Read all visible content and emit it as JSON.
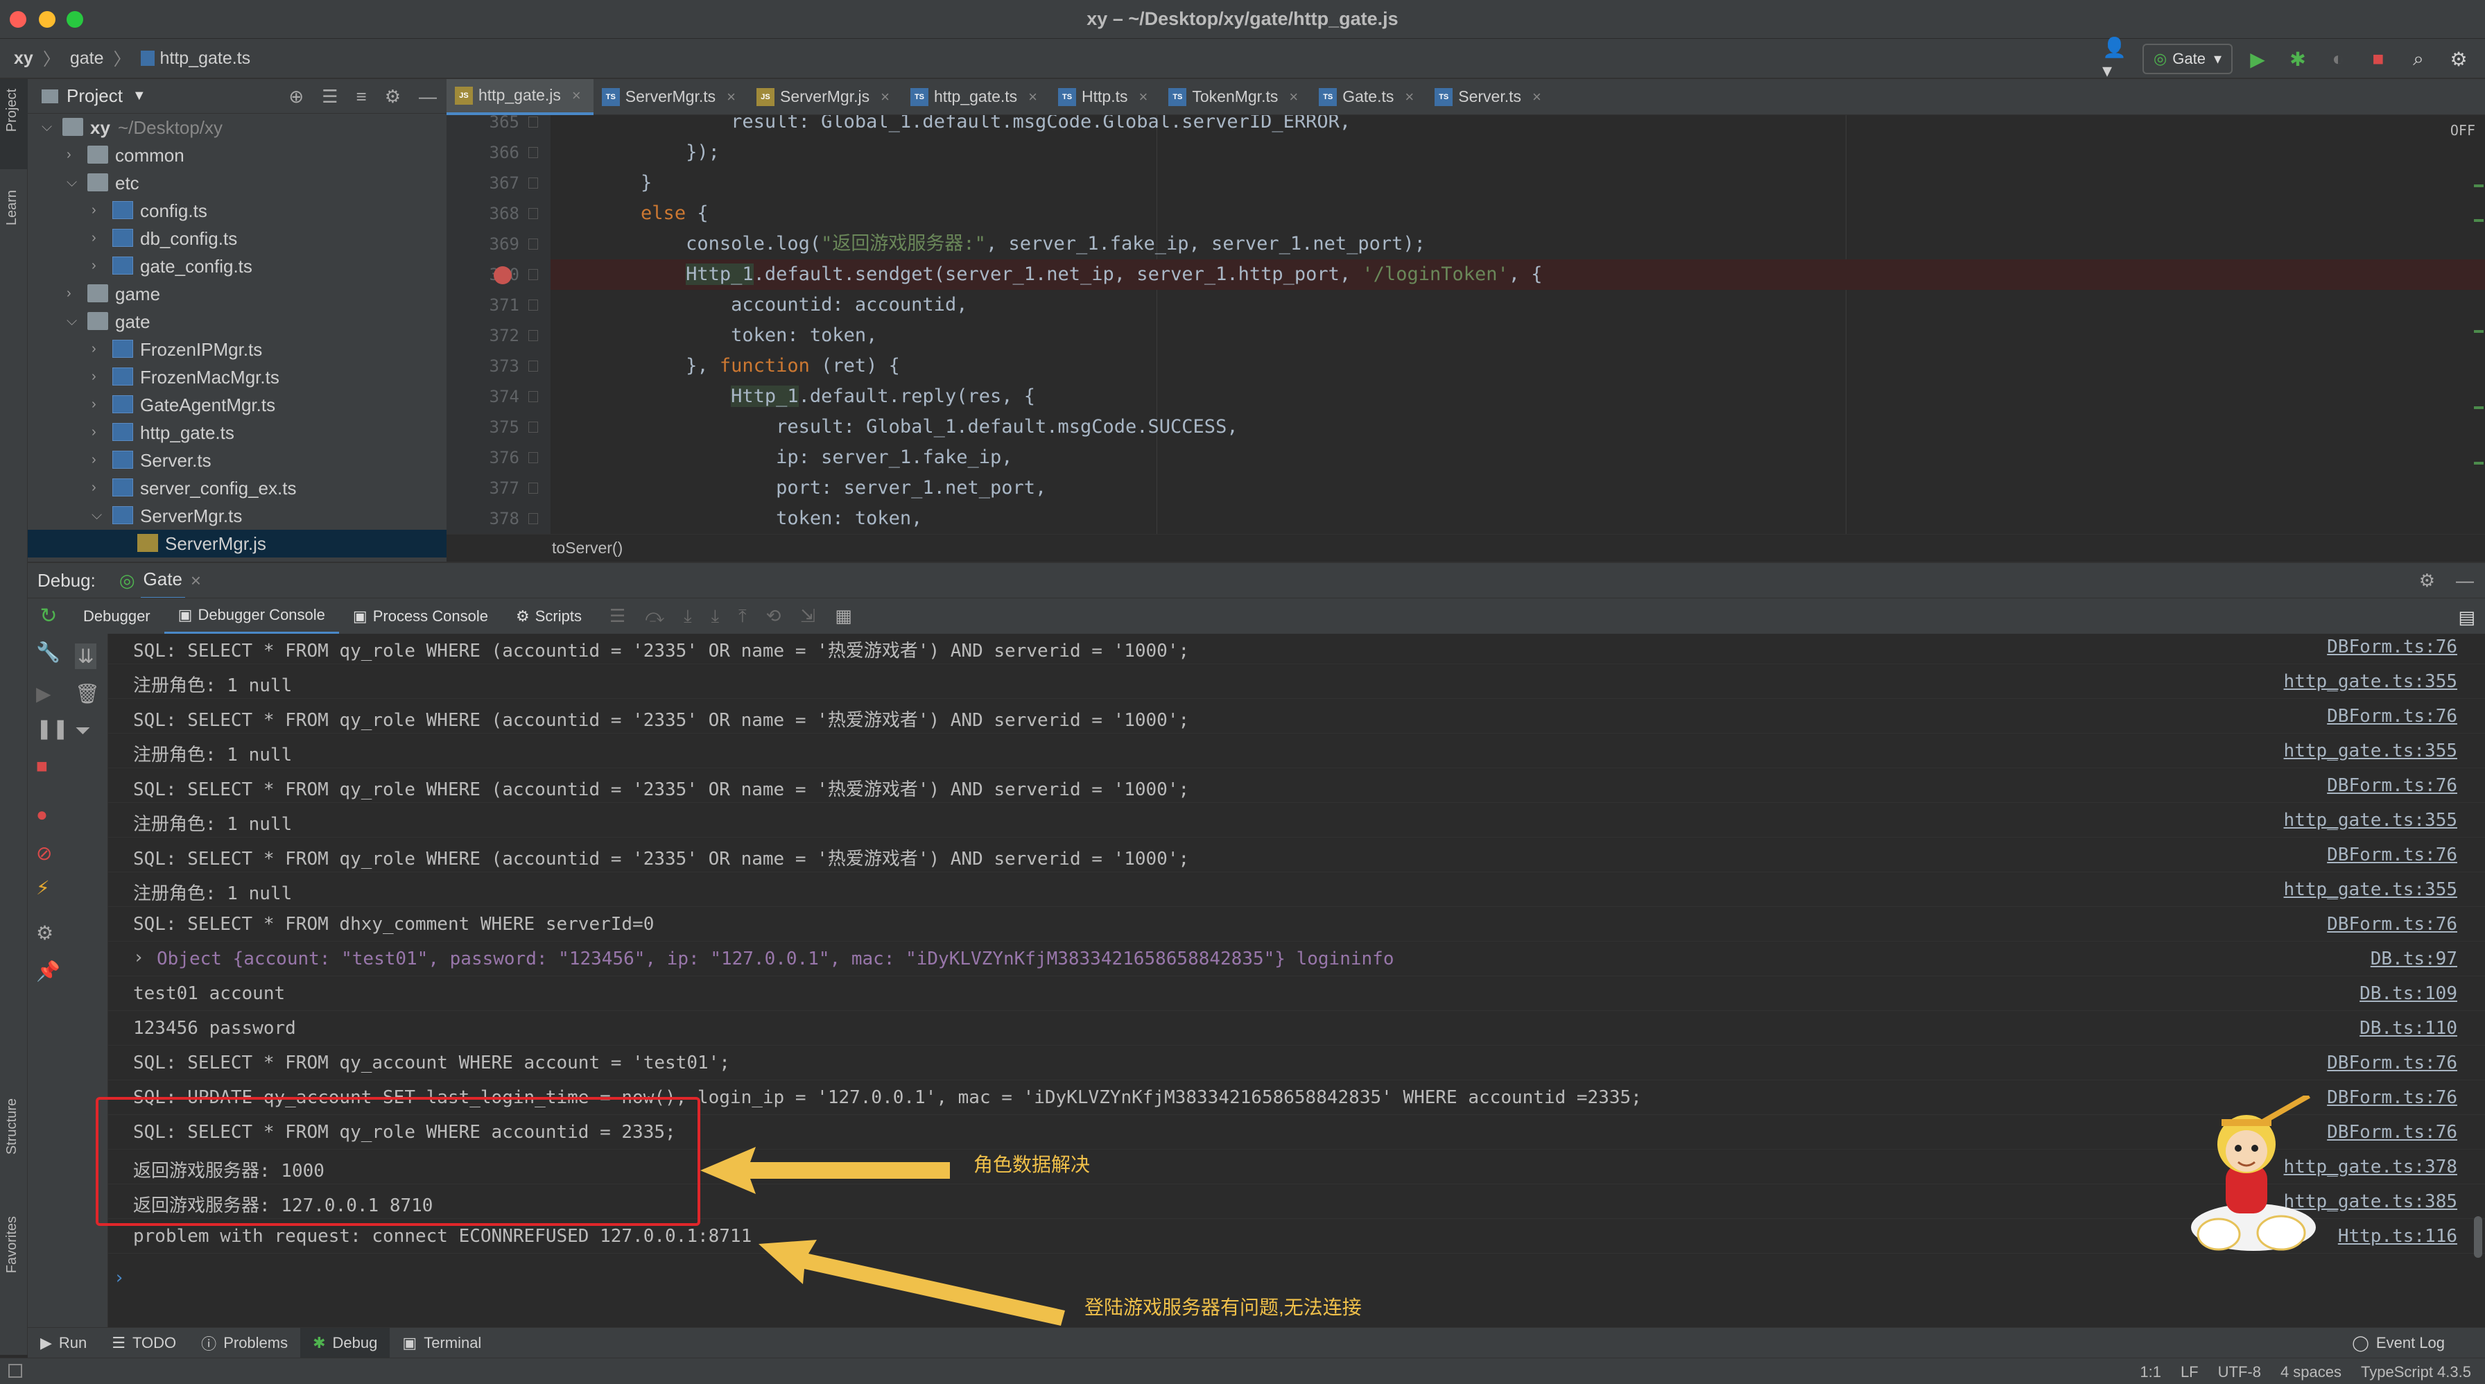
{
  "window": {
    "title": "xy – ~/Desktop/xy/gate/http_gate.js"
  },
  "colors": {
    "close": "#fe5f57",
    "minimize": "#febc2e",
    "maximize": "#28c840",
    "accent": "#4a88c7",
    "annotation": "#f0c04a",
    "highlight_box": "#e0262a"
  },
  "navbar": {
    "crumbs": [
      "xy",
      "gate",
      "http_gate.ts"
    ],
    "run_config": "Gate"
  },
  "left_stripe": {
    "project": "Project",
    "learn": "Learn",
    "structure": "Structure",
    "favorites": "Favorites"
  },
  "project": {
    "title": "Project",
    "tree": [
      {
        "label": "xy",
        "extra": "~/Desktop/xy",
        "type": "folder",
        "depth": 0,
        "expanded": true
      },
      {
        "label": "common",
        "type": "folder",
        "depth": 1,
        "expanded": false
      },
      {
        "label": "etc",
        "type": "folder",
        "depth": 1,
        "expanded": true
      },
      {
        "label": "config.ts",
        "type": "ts",
        "depth": 2,
        "expanded": false
      },
      {
        "label": "db_config.ts",
        "type": "ts",
        "depth": 2,
        "expanded": false
      },
      {
        "label": "gate_config.ts",
        "type": "ts",
        "depth": 2,
        "expanded": false
      },
      {
        "label": "game",
        "type": "folder",
        "depth": 1,
        "expanded": false
      },
      {
        "label": "gate",
        "type": "folder",
        "depth": 1,
        "expanded": true
      },
      {
        "label": "FrozenIPMgr.ts",
        "type": "ts",
        "depth": 2,
        "expanded": false
      },
      {
        "label": "FrozenMacMgr.ts",
        "type": "ts",
        "depth": 2,
        "expanded": false
      },
      {
        "label": "GateAgentMgr.ts",
        "type": "ts",
        "depth": 2,
        "expanded": false
      },
      {
        "label": "http_gate.ts",
        "type": "ts",
        "depth": 2,
        "expanded": false
      },
      {
        "label": "Server.ts",
        "type": "ts",
        "depth": 2,
        "expanded": false
      },
      {
        "label": "server_config_ex.ts",
        "type": "ts",
        "depth": 2,
        "expanded": false
      },
      {
        "label": "ServerMgr.ts",
        "type": "ts",
        "depth": 2,
        "expanded": true
      },
      {
        "label": "ServerMgr.js",
        "type": "js",
        "depth": 3,
        "selected": true
      }
    ]
  },
  "editor_tabs": [
    {
      "label": "http_gate.js",
      "type": "js",
      "active": true
    },
    {
      "label": "ServerMgr.ts",
      "type": "ts"
    },
    {
      "label": "ServerMgr.js",
      "type": "js"
    },
    {
      "label": "http_gate.ts",
      "type": "ts"
    },
    {
      "label": "Http.ts",
      "type": "ts"
    },
    {
      "label": "TokenMgr.ts",
      "type": "ts"
    },
    {
      "label": "Gate.ts",
      "type": "ts"
    },
    {
      "label": "Server.ts",
      "type": "ts"
    }
  ],
  "editor": {
    "off_label": "OFF",
    "breadcrumb": "toServer()",
    "lines": [
      {
        "n": "365",
        "tokens": [
          [
            "                ",
            ""
          ],
          [
            "result: Global_1.default.msgCode.Global.serverID_ERROR,",
            ""
          ]
        ]
      },
      {
        "n": "366",
        "tokens": [
          [
            "            });",
            ""
          ]
        ]
      },
      {
        "n": "367",
        "tokens": [
          [
            "        }",
            ""
          ]
        ]
      },
      {
        "n": "368",
        "tokens": [
          [
            "        ",
            ""
          ],
          [
            "else",
            "kw"
          ],
          [
            " {",
            ""
          ]
        ]
      },
      {
        "n": "369",
        "tokens": [
          [
            "            console.",
            ""
          ],
          [
            "log",
            ""
          ],
          [
            "(",
            ""
          ],
          [
            "\"返回游戏服务器:\"",
            "str"
          ],
          [
            ", server_1.",
            ""
          ],
          [
            "fake_ip",
            ""
          ],
          [
            ", server_1.",
            ""
          ],
          [
            "net_port",
            ""
          ],
          [
            ");",
            ""
          ]
        ]
      },
      {
        "n": "370",
        "breakpoint": true,
        "tokens": [
          [
            "            ",
            ""
          ],
          [
            "Http_1",
            "hl"
          ],
          [
            ".default.sendget(server_1.net_ip, server_1.http_port, ",
            ""
          ],
          [
            "'/loginToken'",
            "str"
          ],
          [
            ", {",
            ""
          ]
        ]
      },
      {
        "n": "371",
        "tokens": [
          [
            "                accountid: accountid,",
            ""
          ]
        ]
      },
      {
        "n": "372",
        "tokens": [
          [
            "                token: token,",
            ""
          ]
        ]
      },
      {
        "n": "373",
        "tokens": [
          [
            "            }, ",
            ""
          ],
          [
            "function",
            "kw"
          ],
          [
            " (ret) {",
            ""
          ]
        ]
      },
      {
        "n": "374",
        "tokens": [
          [
            "                ",
            ""
          ],
          [
            "Http_1",
            "hl"
          ],
          [
            ".default.reply(res, {",
            ""
          ]
        ]
      },
      {
        "n": "375",
        "tokens": [
          [
            "                    result: Global_1.default.msgCode.SUCCESS,",
            ""
          ]
        ]
      },
      {
        "n": "376",
        "tokens": [
          [
            "                    ip: server_1.fake_ip,",
            ""
          ]
        ]
      },
      {
        "n": "377",
        "tokens": [
          [
            "                    port: server_1.net_port,",
            ""
          ]
        ]
      },
      {
        "n": "378",
        "tokens": [
          [
            "                    token: token,",
            ""
          ]
        ]
      }
    ]
  },
  "debug": {
    "label": "Debug:",
    "session": "Gate",
    "tabs": [
      "Debugger",
      "Debugger Console",
      "Process Console",
      "Scripts"
    ],
    "active_tab": "Debugger Console"
  },
  "console_rows": [
    {
      "text": "SQL: SELECT * FROM qy_role WHERE (accountid = '2335' OR name = '热爱游戏者') AND serverid = '1000';",
      "src": "DBForm.ts:76"
    },
    {
      "text": "注册角色: 1 null",
      "src": "http_gate.ts:355"
    },
    {
      "text": "SQL: SELECT * FROM qy_role WHERE (accountid = '2335' OR name = '热爱游戏者') AND serverid = '1000';",
      "src": "DBForm.ts:76"
    },
    {
      "text": "注册角色: 1 null",
      "src": "http_gate.ts:355"
    },
    {
      "text": "SQL: SELECT * FROM qy_role WHERE (accountid = '2335' OR name = '热爱游戏者') AND serverid = '1000';",
      "src": "DBForm.ts:76"
    },
    {
      "text": "注册角色: 1 null",
      "src": "http_gate.ts:355"
    },
    {
      "text": "SQL: SELECT * FROM qy_role WHERE (accountid = '2335' OR name = '热爱游戏者') AND serverid = '1000';",
      "src": "DBForm.ts:76"
    },
    {
      "text": "注册角色: 1 null",
      "src": "http_gate.ts:355"
    },
    {
      "text": "SQL: SELECT * FROM dhxy_comment WHERE serverId=0",
      "src": "DBForm.ts:76"
    },
    {
      "text": "Object {account: \"test01\", password: \"123456\", ip: \"127.0.0.1\", mac: \"iDyKLVZYnKfjM3833421658658842835\"} logininfo",
      "src": "DB.ts:97",
      "object": true
    },
    {
      "text": "test01 account",
      "src": "DB.ts:109"
    },
    {
      "text": "123456 password",
      "src": "DB.ts:110"
    },
    {
      "text": "SQL: SELECT * FROM qy_account WHERE account = 'test01';",
      "src": "DBForm.ts:76"
    },
    {
      "text": "SQL: UPDATE qy_account SET last_login_time = now(), login_ip = '127.0.0.1', mac = 'iDyKLVZYnKfjM3833421658658842835' WHERE accountid =2335;",
      "src": "DBForm.ts:76"
    },
    {
      "text": "SQL: SELECT * FROM qy_role WHERE accountid = 2335;",
      "src": "DBForm.ts:76"
    },
    {
      "text": "返回游戏服务器: 1000",
      "src": "http_gate.ts:378"
    },
    {
      "text": "返回游戏服务器: 127.0.0.1 8710",
      "src": "http_gate.ts:385"
    },
    {
      "text": "problem with request: connect ECONNREFUSED 127.0.0.1:8711",
      "src": "Http.ts:116"
    }
  ],
  "annotations": {
    "role_data": "角色数据解决",
    "login_issue": "登陆游戏服务器有问题,无法连接"
  },
  "bottom_tabs": [
    "Run",
    "TODO",
    "Problems",
    "Debug",
    "Terminal"
  ],
  "event_log": "Event Log",
  "status": {
    "position": "1:1",
    "line_sep": "LF",
    "encoding": "UTF-8",
    "indent": "4 spaces",
    "lang": "TypeScript 4.3.5"
  }
}
